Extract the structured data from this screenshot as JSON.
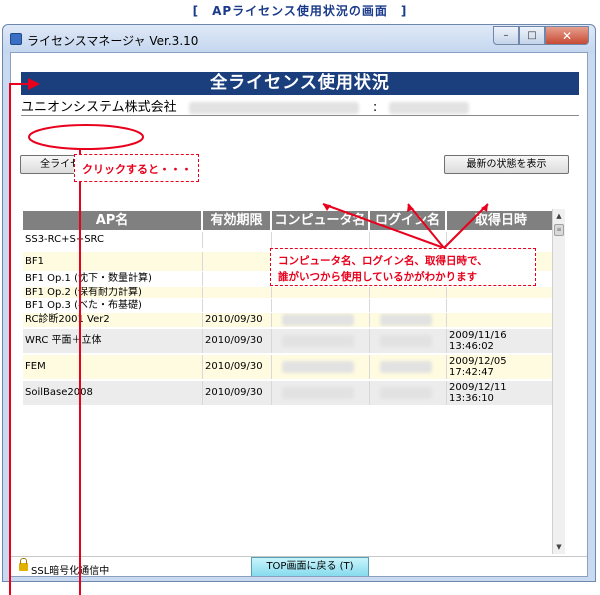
{
  "caption": "[　APライセンス使用状況の画面　]",
  "window": {
    "title": "ライセンスマネージャ Ver.3.10",
    "min_glyph": "–",
    "max_glyph": "□",
    "close_glyph": "✕"
  },
  "header": {
    "title": "全ライセンス使用状況",
    "company": "ユニオンシステム株式会社",
    "separator": ":"
  },
  "buttons": {
    "usage_log": "全ライセンス使用ログ",
    "refresh": "最新の状態を表示",
    "top": "TOP画面に戻る (T)"
  },
  "table": {
    "columns": [
      "AP名",
      "有効期限",
      "コンピュータ名",
      "ログイン名",
      "取得日時"
    ],
    "rows": [
      {
        "ap": "SS3-RC+S+SRC",
        "expire": "",
        "computer": "",
        "login": "",
        "date": "",
        "time": ""
      },
      {
        "ap": "BF1",
        "expire": "",
        "computer": "",
        "login": "",
        "date": "",
        "time": ""
      },
      {
        "ap": "BF1 Op.1 (沈下・数量計算)",
        "expire": "",
        "computer": "",
        "login": "",
        "date": "",
        "time": ""
      },
      {
        "ap": "BF1 Op.2 (保有耐力計算)",
        "expire": "",
        "computer": "",
        "login": "",
        "date": "",
        "time": ""
      },
      {
        "ap": "BF1 Op.3 (べた・布基礎)",
        "expire": "",
        "computer": "",
        "login": "",
        "date": "",
        "time": ""
      },
      {
        "ap": "RC診断2001 Ver2",
        "expire": "2010/09/30",
        "computer": "",
        "login": "",
        "date": "",
        "time": ""
      },
      {
        "ap": "WRC 平面＋立体",
        "expire": "2010/09/30",
        "computer": "",
        "login": "",
        "date": "2009/11/16",
        "time": "13:46:02"
      },
      {
        "ap": "FEM",
        "expire": "2010/09/30",
        "computer": "",
        "login": "",
        "date": "2009/12/05",
        "time": "17:42:47"
      },
      {
        "ap": "SoilBase2008",
        "expire": "2010/09/30",
        "computer": "",
        "login": "",
        "date": "2009/12/11",
        "time": "13:36:10"
      }
    ]
  },
  "scrollbar": {
    "up": "▲",
    "down": "▼",
    "thumb": "≡"
  },
  "status": {
    "ssl": "SSL暗号化通信中"
  },
  "annotations": {
    "click_note": "クリックすると・・・",
    "callout_line1": "コンピュータ名、ログイン名、取得日時で、",
    "callout_line2": "誰がいつから使用しているかがわかります"
  },
  "colors": {
    "header_bg": "#1b3f7d",
    "table_header_bg": "#808080",
    "row_highlight": "#fffbe0",
    "row_light": "#ececec",
    "annotation": "#e8001c"
  }
}
